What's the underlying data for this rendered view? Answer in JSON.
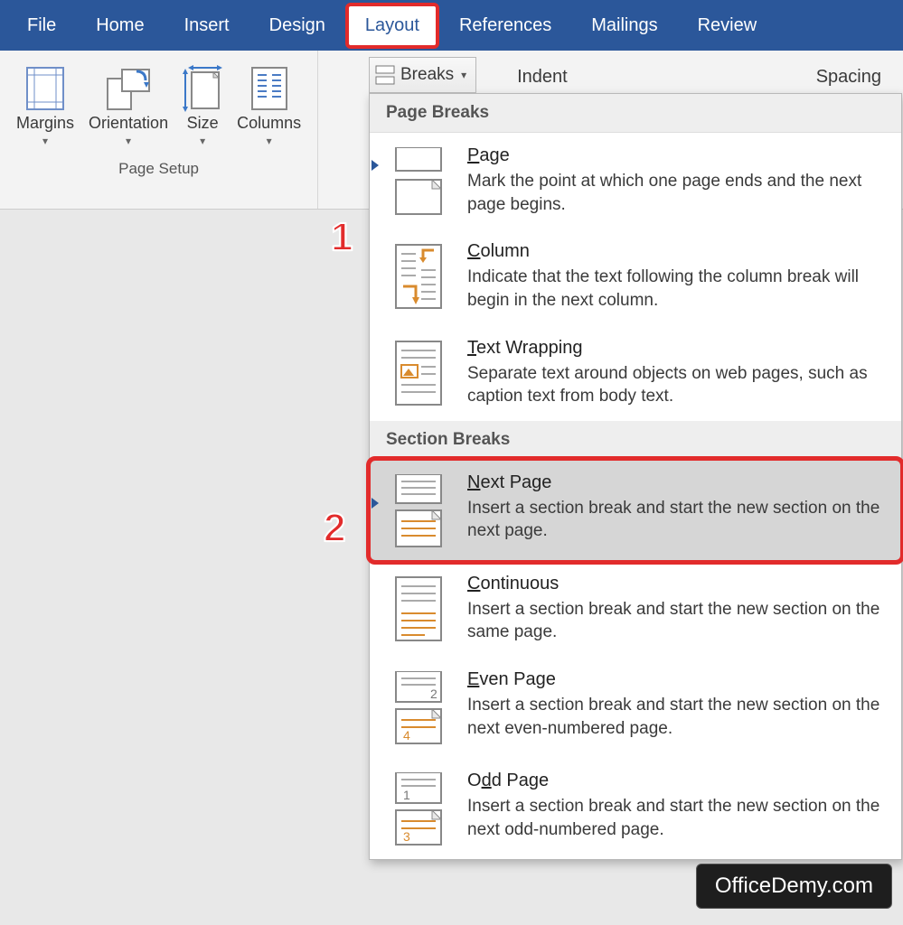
{
  "tabs": [
    "File",
    "Home",
    "Insert",
    "Design",
    "Layout",
    "References",
    "Mailings",
    "Review"
  ],
  "active_tab_index": 4,
  "ribbon": {
    "page_setup": {
      "buttons": [
        "Margins",
        "Orientation",
        "Size",
        "Columns"
      ],
      "group_label": "Page Setup"
    },
    "breaks_label": "Breaks",
    "right_labels": [
      "Indent",
      "Spacing"
    ]
  },
  "dropdown": {
    "groups": [
      {
        "header": "Page Breaks",
        "items": [
          {
            "title": "Page",
            "underline": "P",
            "desc": "Mark the point at which one page ends and the next page begins."
          },
          {
            "title": "Column",
            "underline": "C",
            "desc": "Indicate that the text following the column break will begin in the next column."
          },
          {
            "title": "Text Wrapping",
            "underline": "T",
            "desc": "Separate text around objects on web pages, such as caption text from body text."
          }
        ]
      },
      {
        "header": "Section Breaks",
        "items": [
          {
            "title": "Next Page",
            "underline": "N",
            "desc": "Insert a section break and start the new section on the next page.",
            "selected": true
          },
          {
            "title": "Continuous",
            "underline": "C",
            "desc": "Insert a section break and start the new section on the same page."
          },
          {
            "title": "Even Page",
            "underline": "E",
            "desc": "Insert a section break and start the new section on the next even-numbered page."
          },
          {
            "title": "Odd Page",
            "underline": "d",
            "desc": "Insert a section break and start the new section on the next odd-numbered page."
          }
        ]
      }
    ]
  },
  "callouts": {
    "one": "1",
    "two": "2"
  },
  "watermark": "OfficeDemy.com"
}
